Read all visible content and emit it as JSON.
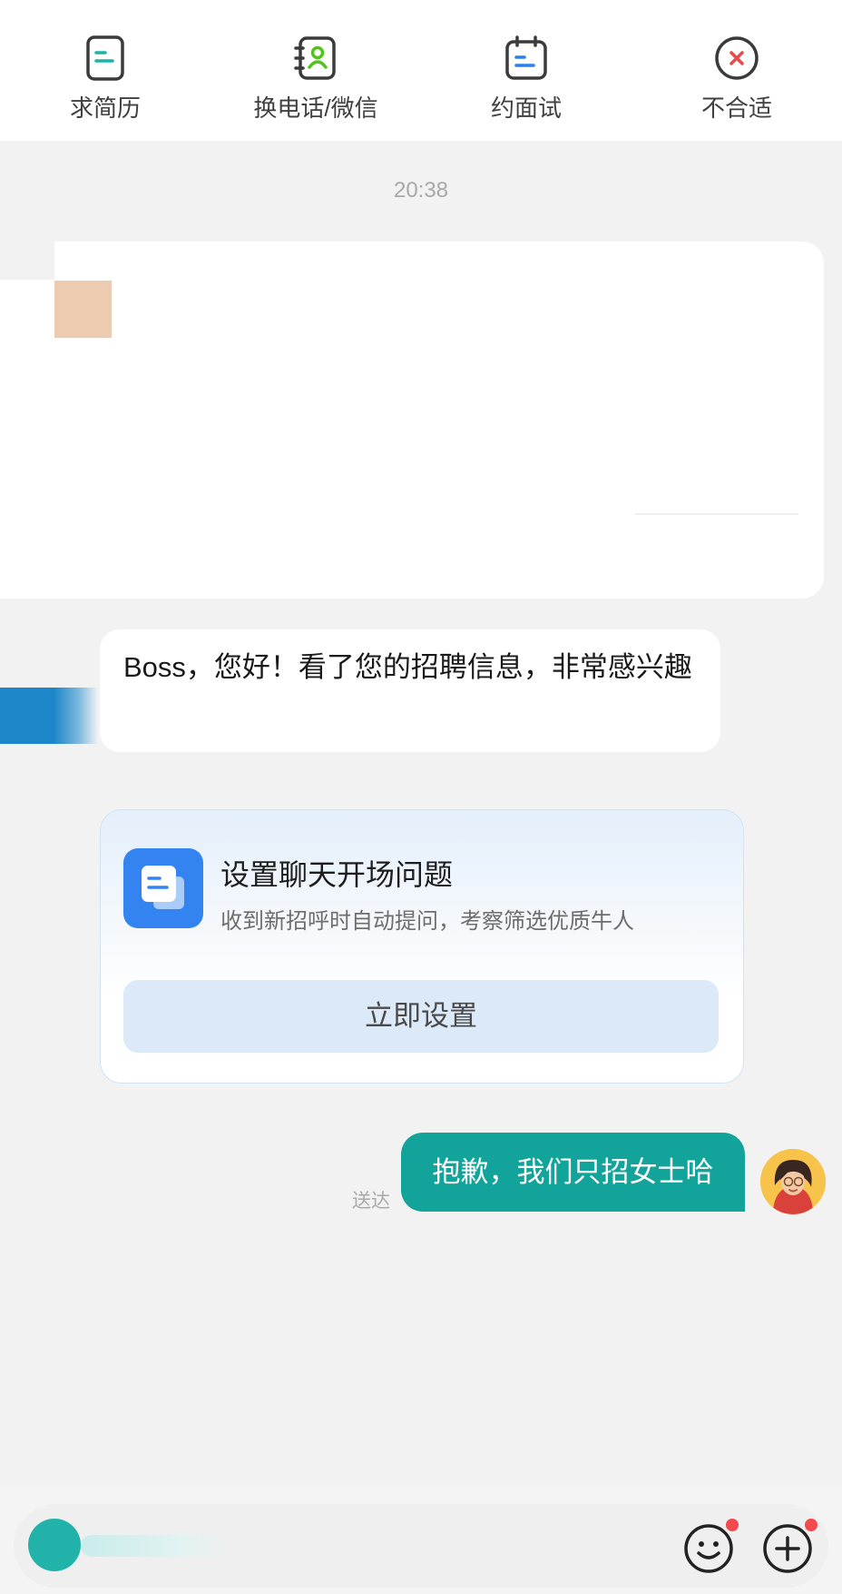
{
  "toolbar": {
    "items": [
      {
        "label": "求简历",
        "icon": "resume-icon",
        "color": "#1bb3a9"
      },
      {
        "label": "换电话/微信",
        "icon": "contact-card-icon",
        "color": "#52c41a"
      },
      {
        "label": "约面试",
        "icon": "calendar-icon",
        "color": "#2f7fea"
      },
      {
        "label": "不合适",
        "icon": "reject-icon",
        "color": "#e84a4a"
      }
    ]
  },
  "chat": {
    "time": "20:38",
    "received": {
      "text": "Boss，您好！看了您的招聘信息，非常感兴趣"
    },
    "setup_card": {
      "title": "设置聊天开场问题",
      "subtitle": "收到新招呼时自动提问，考察筛选优质牛人",
      "button": "立即设置",
      "icon": "document-icon"
    },
    "sent": {
      "text": "抱歉，我们只招女士哈",
      "status": "送达"
    }
  },
  "input_bar": {
    "emoji_icon": "emoji-icon",
    "plus_icon": "plus-icon"
  },
  "colors": {
    "accent": "#12a49b",
    "badge": "#f2494f"
  }
}
